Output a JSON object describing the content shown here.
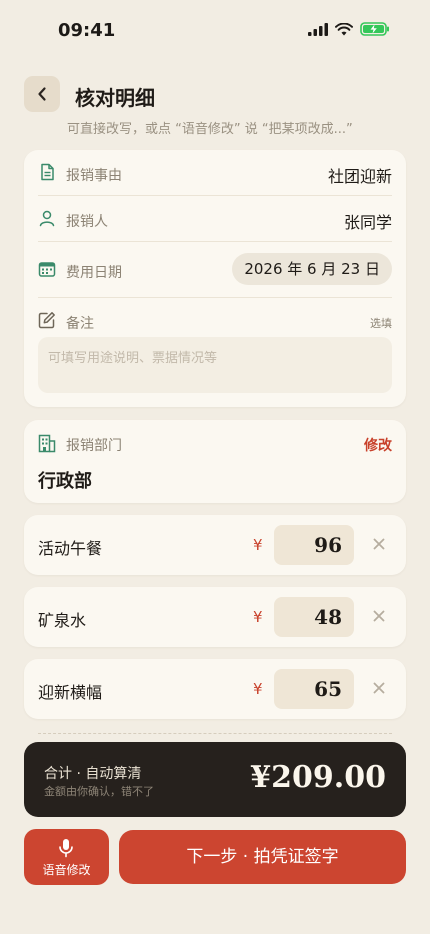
{
  "status_bar": {
    "time": "09:41"
  },
  "header": {
    "title": "核对明细",
    "hint": "可直接改写，或点 “语音修改” 说 “把某项改成...”"
  },
  "info": {
    "reason_label": "报销事由",
    "reason_value": "社团迎新",
    "person_label": "报销人",
    "person_value": "张同学",
    "date_label": "费用日期",
    "date_value": "2026 年 6 月 23 日",
    "note_label": "备注",
    "note_optional": "选填",
    "note_placeholder": "可填写用途说明、票据情况等"
  },
  "department": {
    "label": "报销部门",
    "edit": "修改",
    "value": "行政部"
  },
  "currency_symbol": "¥",
  "items": [
    {
      "name": "活动午餐",
      "amount": "96"
    },
    {
      "name": "矿泉水",
      "amount": "48"
    },
    {
      "name": "迎新横幅",
      "amount": "65"
    }
  ],
  "total": {
    "label": "合计 · 自动算清",
    "sub": "金额由你确认，错不了",
    "value": "¥209.00"
  },
  "actions": {
    "voice_label": "语音修改",
    "next_label": "下一步 · 拍凭证签字"
  },
  "colors": {
    "accent": "#cc4530",
    "background": "#f2ede3",
    "card": "#fbf8f1",
    "icon_green": "#3a8a6a",
    "total_bg": "#26211d"
  }
}
